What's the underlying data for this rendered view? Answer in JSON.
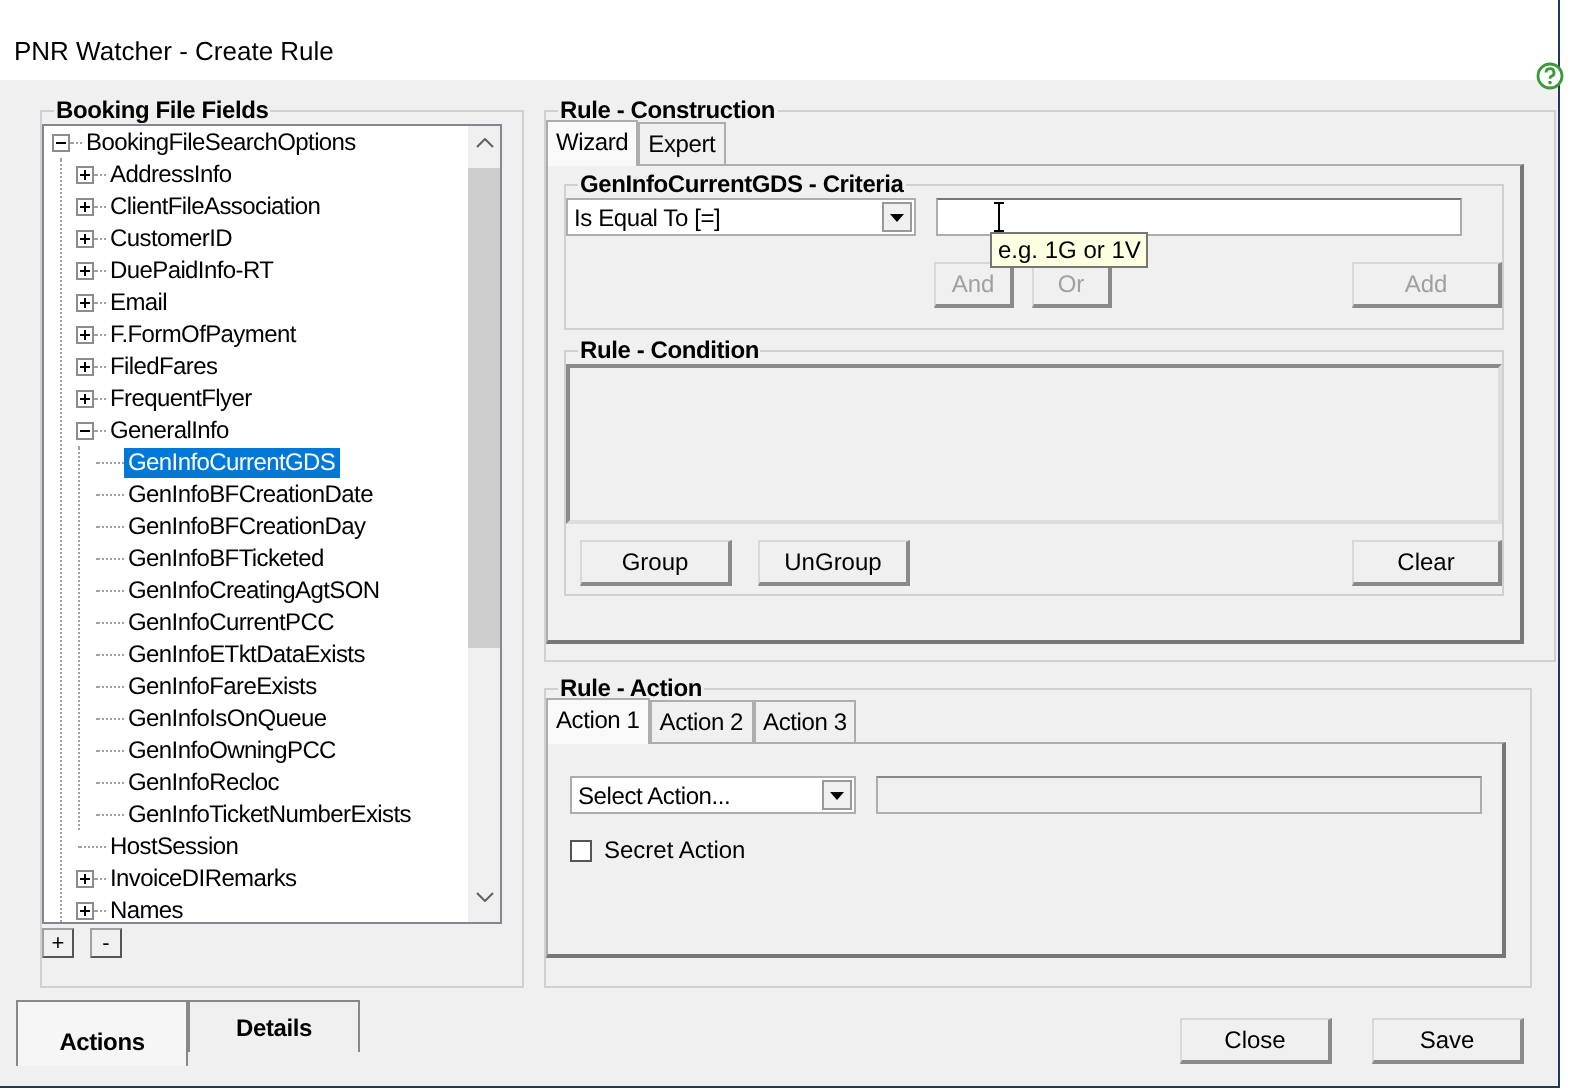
{
  "window": {
    "title": "PNR Watcher - Create Rule"
  },
  "booking_file_fields": {
    "title": "Booking File Fields",
    "tree": [
      {
        "label": "BookingFileSearchOptions",
        "kind": "group",
        "expanded": true,
        "selected": false,
        "children": [
          {
            "label": "AddressInfo",
            "kind": "group",
            "expanded": false,
            "selected": false
          },
          {
            "label": "ClientFileAssociation",
            "kind": "group",
            "expanded": false,
            "selected": false
          },
          {
            "label": "CustomerID",
            "kind": "group",
            "expanded": false,
            "selected": false
          },
          {
            "label": "DuePaidInfo-RT",
            "kind": "group",
            "expanded": false,
            "selected": false
          },
          {
            "label": "Email",
            "kind": "group",
            "expanded": false,
            "selected": false
          },
          {
            "label": "F.FormOfPayment",
            "kind": "group",
            "expanded": false,
            "selected": false
          },
          {
            "label": "FiledFares",
            "kind": "group",
            "expanded": false,
            "selected": false
          },
          {
            "label": "FrequentFlyer",
            "kind": "group",
            "expanded": false,
            "selected": false
          },
          {
            "label": "GeneralInfo",
            "kind": "group",
            "expanded": true,
            "selected": false,
            "children": [
              {
                "label": "GenInfoCurrentGDS",
                "kind": "leaf",
                "selected": true
              },
              {
                "label": "GenInfoBFCreationDate",
                "kind": "leaf",
                "selected": false
              },
              {
                "label": "GenInfoBFCreationDay",
                "kind": "leaf",
                "selected": false
              },
              {
                "label": "GenInfoBFTicketed",
                "kind": "leaf",
                "selected": false
              },
              {
                "label": "GenInfoCreatingAgtSON",
                "kind": "leaf",
                "selected": false
              },
              {
                "label": "GenInfoCurrentPCC",
                "kind": "leaf",
                "selected": false
              },
              {
                "label": "GenInfoETktDataExists",
                "kind": "leaf",
                "selected": false
              },
              {
                "label": "GenInfoFareExists",
                "kind": "leaf",
                "selected": false
              },
              {
                "label": "GenInfoIsOnQueue",
                "kind": "leaf",
                "selected": false
              },
              {
                "label": "GenInfoOwningPCC",
                "kind": "leaf",
                "selected": false
              },
              {
                "label": "GenInfoRecloc",
                "kind": "leaf",
                "selected": false
              },
              {
                "label": "GenInfoTicketNumberExists",
                "kind": "leaf",
                "selected": false
              }
            ]
          },
          {
            "label": "HostSession",
            "kind": "leaf",
            "selected": false
          },
          {
            "label": "InvoiceDIRemarks",
            "kind": "group",
            "expanded": false,
            "selected": false
          },
          {
            "label": "Names",
            "kind": "group",
            "expanded": false,
            "selected": false
          }
        ]
      }
    ],
    "buttons": [
      "+",
      "-"
    ]
  },
  "rule_construction": {
    "title": "Rule - Construction",
    "tabs": [
      {
        "label": "Wizard",
        "selected": true
      },
      {
        "label": "Expert",
        "selected": false
      }
    ],
    "criteria": {
      "title": "GenInfoCurrentGDS - Criteria",
      "operator": "Is Equal To [=]",
      "tooltip": "e.g. 1G or 1V",
      "buttons": [
        {
          "label": "And",
          "disabled": true
        },
        {
          "label": "Or",
          "disabled": true
        },
        {
          "label": "Add",
          "disabled": true
        }
      ]
    },
    "condition": {
      "title": "Rule - Condition",
      "buttons": [
        {
          "label": "Group",
          "disabled": false
        },
        {
          "label": "UnGroup",
          "disabled": false
        },
        {
          "label": "Clear",
          "disabled": false
        }
      ]
    }
  },
  "rule_action": {
    "title": "Rule - Action",
    "tabs": [
      {
        "label": "Action 1",
        "selected": true
      },
      {
        "label": "Action 2",
        "selected": false
      },
      {
        "label": "Action 3",
        "selected": false
      }
    ],
    "action_select": "Select Action...",
    "action_field": {
      "disabled": true
    },
    "secret_action": {
      "label": "Secret Action",
      "checked": false
    }
  },
  "bottom_tabs": [
    {
      "label": "Actions",
      "selected": true
    },
    {
      "label": "Details",
      "selected": false
    }
  ],
  "footer_buttons": [
    "Close",
    "Save"
  ]
}
